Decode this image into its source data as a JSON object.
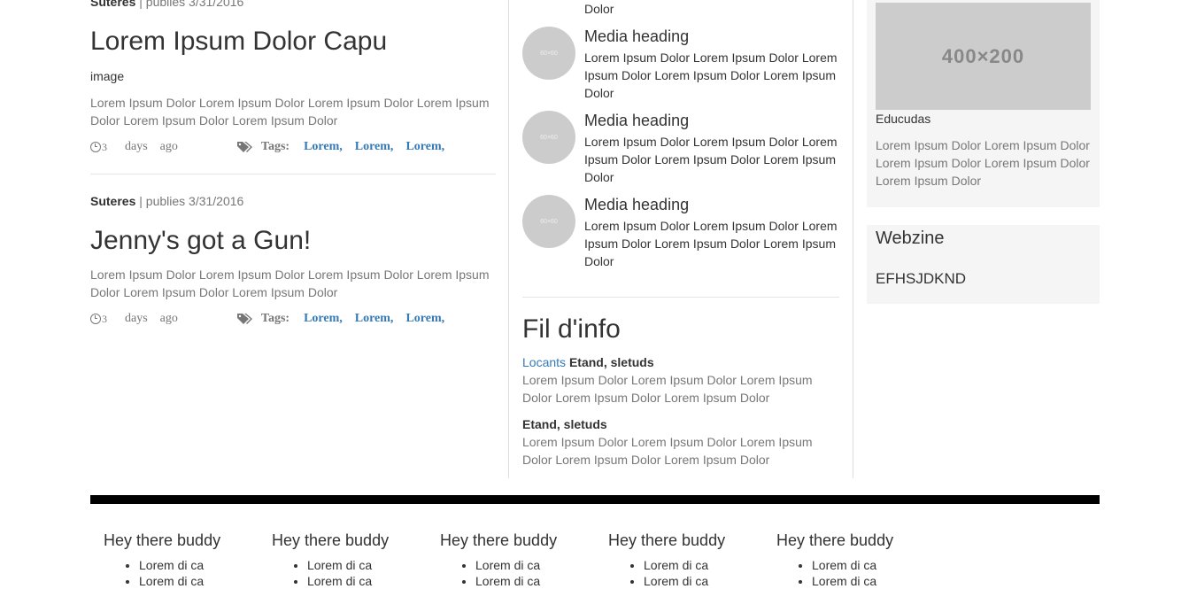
{
  "articles": [
    {
      "author": "Suteres",
      "published": "| publies 3/31/2016",
      "title": "Lorem Ipsum Dolor Capu",
      "image_label": "image",
      "excerpt": "Lorem Ipsum Dolor Lorem Ipsum Dolor Lorem Ipsum Dolor Lorem Ipsum Dolor Lorem Ipsum Dolor Lorem Ipsum Dolor",
      "time_count": "3",
      "time_unit": "days",
      "time_ago": "ago",
      "tags_label": "Tags:",
      "tags": [
        "Lorem,",
        "Lorem,",
        "Lorem,"
      ]
    },
    {
      "author": "Suteres",
      "published": "| publies 3/31/2016",
      "title": "Jenny's got a Gun!",
      "excerpt": "Lorem Ipsum Dolor Lorem Ipsum Dolor Lorem Ipsum Dolor Lorem Ipsum Dolor Lorem Ipsum Dolor Lorem Ipsum Dolor",
      "time_count": "3",
      "time_unit": "days",
      "time_ago": "ago",
      "tags_label": "Tags:",
      "tags": [
        "Lorem,",
        "Lorem,",
        "Lorem,"
      ]
    }
  ],
  "media": {
    "top_fragment": "Dolor",
    "thumb_label": "60×60",
    "items": [
      {
        "heading": "Media heading",
        "text": "Lorem Ipsum Dolor Lorem Ipsum Dolor Lorem Ipsum Dolor Lorem Ipsum Dolor Lorem Ipsum Dolor"
      },
      {
        "heading": "Media heading",
        "text": "Lorem Ipsum Dolor Lorem Ipsum Dolor Lorem Ipsum Dolor Lorem Ipsum Dolor Lorem Ipsum Dolor"
      },
      {
        "heading": "Media heading",
        "text": "Lorem Ipsum Dolor Lorem Ipsum Dolor Lorem Ipsum Dolor Lorem Ipsum Dolor Lorem Ipsum Dolor"
      }
    ]
  },
  "fil_info": {
    "title": "Fil d'info",
    "items": [
      {
        "link": "Locants",
        "bold": "Etand, sletuds",
        "text": "Lorem Ipsum Dolor Lorem Ipsum Dolor Lorem Ipsum Dolor Lorem Ipsum Dolor Lorem Ipsum Dolor"
      },
      {
        "bold": "Etand, sletuds",
        "text": "Lorem Ipsum Dolor Lorem Ipsum Dolor Lorem Ipsum Dolor Lorem Ipsum Dolor Lorem Ipsum Dolor"
      }
    ]
  },
  "sidebar": {
    "image_label": "400×200",
    "caption": "Educudas",
    "text": "Lorem Ipsum Dolor Lorem Ipsum Dolor Lorem Ipsum Dolor Lorem Ipsum Dolor Lorem Ipsum Dolor",
    "webzine_title": "Webzine",
    "webzine_body": "EFHSJDKND"
  },
  "footer": {
    "columns": [
      {
        "title": "Hey there buddy",
        "items": [
          "Lorem di ca",
          "Lorem di ca"
        ]
      },
      {
        "title": "Hey there buddy",
        "items": [
          "Lorem di ca",
          "Lorem di ca"
        ]
      },
      {
        "title": "Hey there buddy",
        "items": [
          "Lorem di ca",
          "Lorem di ca"
        ]
      },
      {
        "title": "Hey there buddy",
        "items": [
          "Lorem di ca",
          "Lorem di ca"
        ]
      },
      {
        "title": "Hey there buddy",
        "items": [
          "Lorem di ca",
          "Lorem di ca"
        ]
      }
    ]
  }
}
